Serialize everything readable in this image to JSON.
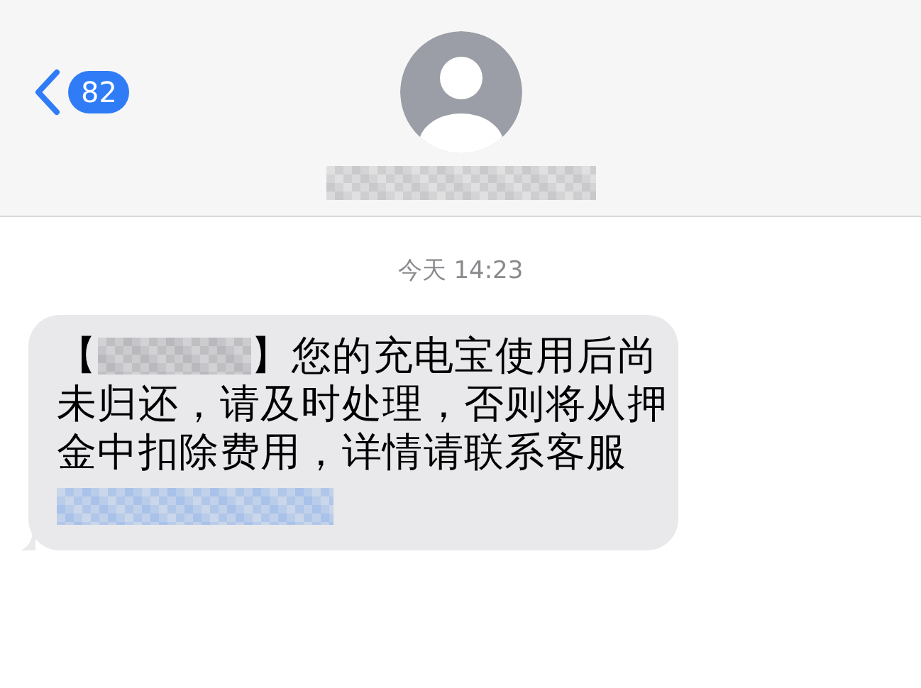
{
  "header": {
    "back_badge": "82"
  },
  "conversation": {
    "timestamp": "今天 14:23",
    "messages": [
      {
        "kind": "incoming",
        "text_before": "【",
        "first_line_after": "】您的充电宝使用后尚",
        "continuation": "未归还，请及时处理，否则将从押金中扣除费用，详情请联系客服"
      }
    ]
  }
}
